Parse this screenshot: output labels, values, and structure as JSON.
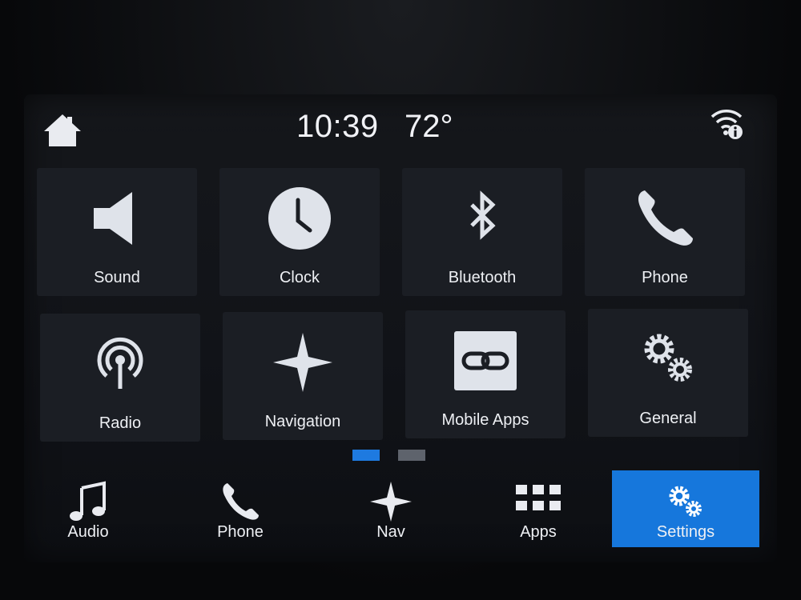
{
  "status": {
    "time": "10:39",
    "temperature": "72°",
    "home_icon": "home-icon",
    "connectivity_icon": "wifi-info-icon"
  },
  "tiles": [
    {
      "label": "Sound",
      "icon": "speaker-icon"
    },
    {
      "label": "Clock",
      "icon": "clock-icon"
    },
    {
      "label": "Bluetooth",
      "icon": "bluetooth-icon"
    },
    {
      "label": "Phone",
      "icon": "phone-icon"
    },
    {
      "label": "Radio",
      "icon": "radio-icon"
    },
    {
      "label": "Navigation",
      "icon": "compass-star-icon"
    },
    {
      "label": "Mobile Apps",
      "icon": "link-icon"
    },
    {
      "label": "General",
      "icon": "gears-icon"
    }
  ],
  "pager": {
    "pages": 2,
    "current": 1,
    "active_color": "#1e7ae0",
    "inactive_color": "#5e636c"
  },
  "bottom_nav": [
    {
      "label": "Audio",
      "icon": "music-note-icon",
      "active": false
    },
    {
      "label": "Phone",
      "icon": "phone-icon",
      "active": false
    },
    {
      "label": "Nav",
      "icon": "compass-star-icon",
      "active": false
    },
    {
      "label": "Apps",
      "icon": "apps-grid-icon",
      "active": false
    },
    {
      "label": "Settings",
      "icon": "gears-icon",
      "active": true
    }
  ],
  "colors": {
    "accent": "#1677dc",
    "tile_bg": "#1b1e24",
    "text": "#eef0f4"
  }
}
